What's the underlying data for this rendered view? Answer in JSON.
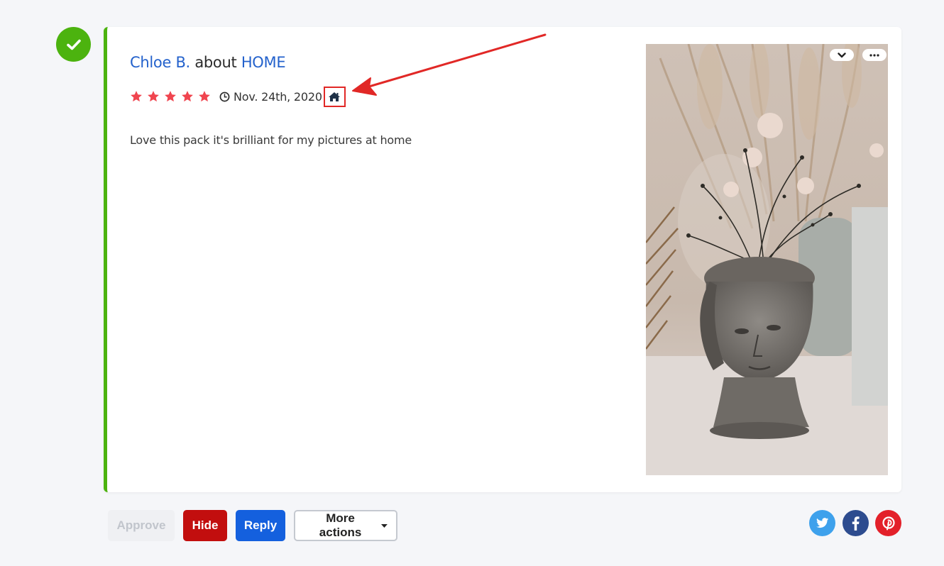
{
  "review": {
    "author": "Chloe B.",
    "about_word": "about",
    "product": "HOME",
    "rating": 5,
    "date": "Nov. 24th, 2020",
    "body": "Love this pack it's brilliant for my pictures at home",
    "status": "approved"
  },
  "colors": {
    "accent_green": "#4cb30f",
    "link_blue": "#2462cc",
    "star_red": "#f0454f",
    "annotation_red": "#e12826"
  },
  "icons": {
    "status": "check-icon",
    "clock": "clock-icon",
    "source": "home-icon",
    "dropdown": "chevron-down-icon",
    "more": "ellipsis-icon"
  },
  "actions": {
    "approve_label": "Approve",
    "hide_label": "Hide",
    "reply_label": "Reply",
    "more_label": "More actions"
  },
  "social": [
    "twitter",
    "facebook",
    "pinterest"
  ]
}
